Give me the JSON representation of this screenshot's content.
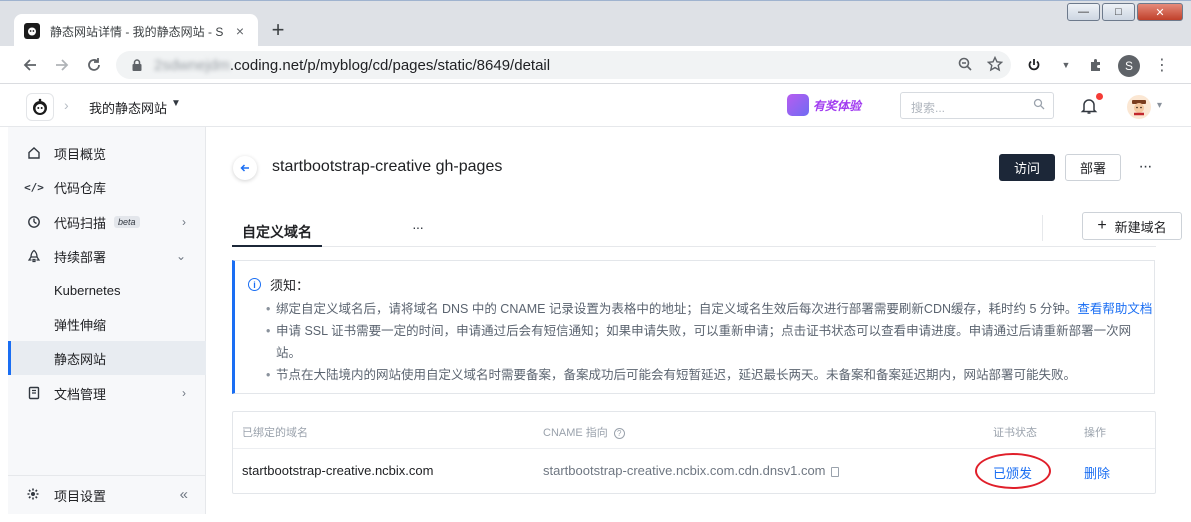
{
  "browser": {
    "tab_title": "静态网站详情 - 我的静态网站 - S",
    "tab_close": "×",
    "new_tab": "+",
    "url_blurred": "2sdwnejdm",
    "url_rest": ".coding.net/p/myblog/cd/pages/static/8649/detail",
    "profile_initial": "S",
    "window_buttons": [
      "—",
      "□",
      "✕"
    ]
  },
  "header": {
    "project_name": "我的静态网站",
    "reward_label": "有奖体验",
    "search_placeholder": "搜索..."
  },
  "sidebar": {
    "items": [
      {
        "label": "项目概览",
        "icon": "home-icon"
      },
      {
        "label": "代码仓库",
        "icon": "code-icon"
      },
      {
        "label": "代码扫描",
        "icon": "scan-icon",
        "badge": "beta"
      },
      {
        "label": "持续部署",
        "icon": "rocket-icon"
      },
      {
        "label": "Kubernetes"
      },
      {
        "label": "弹性伸缩"
      },
      {
        "label": "静态网站"
      },
      {
        "label": "文档管理",
        "icon": "book-icon"
      }
    ],
    "settings_label": "项目设置"
  },
  "main": {
    "title": "startbootstrap-creative gh-pages",
    "visit_label": "访问",
    "deploy_label": "部署",
    "tab_label": "自定义域名",
    "new_domain_label": "新建域名",
    "notice": {
      "title": "须知：",
      "line1": "绑定自定义域名后，请将域名 DNS 中的 CNAME 记录设置为表格中的地址；自定义域名生效后每次进行部署需要刷新CDN缓存，耗时约 5 分钟。",
      "line1_link": "查看帮助文档",
      "line2": "申请 SSL 证书需要一定的时间，申请通过后会有短信通知；如果申请失败，可以重新申请；点击证书状态可以查看申请进度。申请通过后请重新部署一次网站。",
      "line3": "节点在大陆境内的网站使用自定义域名时需要备案，备案成功后可能会有短暂延迟，延迟最长两天。未备案和备案延迟期内，网站部署可能失败。"
    },
    "table": {
      "headers": {
        "domain": "已绑定的域名",
        "cname": "CNAME 指向",
        "cert": "证书状态",
        "action": "操作"
      },
      "rows": [
        {
          "domain": "startbootstrap-creative.ncbix.com",
          "cname": "startbootstrap-creative.ncbix.com.cdn.dnsv1.com",
          "cert_status": "已颁发",
          "action": "删除"
        }
      ]
    }
  },
  "colors": {
    "accent": "#1a6ef3",
    "dark_button": "#1c2738",
    "highlight_ring": "#e01f2a",
    "notification_dot": "#f53b36"
  }
}
